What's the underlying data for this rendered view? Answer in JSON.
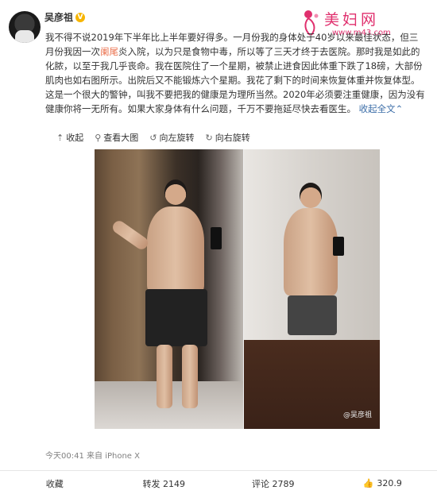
{
  "author": {
    "name": "吴彦祖",
    "verified_badge": "V"
  },
  "watermark": {
    "site_name": "美妇网",
    "site_url": "www.m43.com"
  },
  "post": {
    "text_before_link": "我不得不说2019年下半年比上半年要好得多。一月份我的身体处于40岁以来最佳状态，但三月份我因一次",
    "link_text": "阑尾",
    "text_after_link": "炎入院，以为只是食物中毒，所以等了三天才终于去医院。那时我是如此的化脓，以至于我几乎丧命。我在医院住了一个星期，被禁止进食因此体重下跌了18磅，大部份肌肉也如右图所示。出院后又不能锻炼六个星期。我花了剩下的时间来恢复体重并恢复体型。这是一个很大的警钟，叫我不要把我的健康是为理所当然。2020年必须要注重健康，因为没有健康你将一无所有。如果大家身体有什么问题，千万不要拖延尽快去看医生。",
    "collapse_label": "收起全文"
  },
  "image_toolbar": {
    "collapse": "收起",
    "view_large": "查看大图",
    "rotate_left": "向左旋转",
    "rotate_right": "向右旋转"
  },
  "image": {
    "watermark": "@吴彦祖"
  },
  "meta": {
    "time": "今天00:41",
    "source": "来自 iPhone X"
  },
  "footer": {
    "favorite": "收藏",
    "repost": "转发 2149",
    "comment": "评论 2789",
    "like": "320.9"
  },
  "icons": {
    "collapse": "up-arrow-icon",
    "view_large": "magnifier-icon",
    "rotate_left": "rotate-left-icon",
    "rotate_right": "rotate-right-icon",
    "like": "thumbs-up-icon"
  },
  "colors": {
    "link": "#eb7350",
    "collapse_link": "#3c6ea8",
    "watermark": "#e0306e",
    "verified": "#f7b500"
  }
}
